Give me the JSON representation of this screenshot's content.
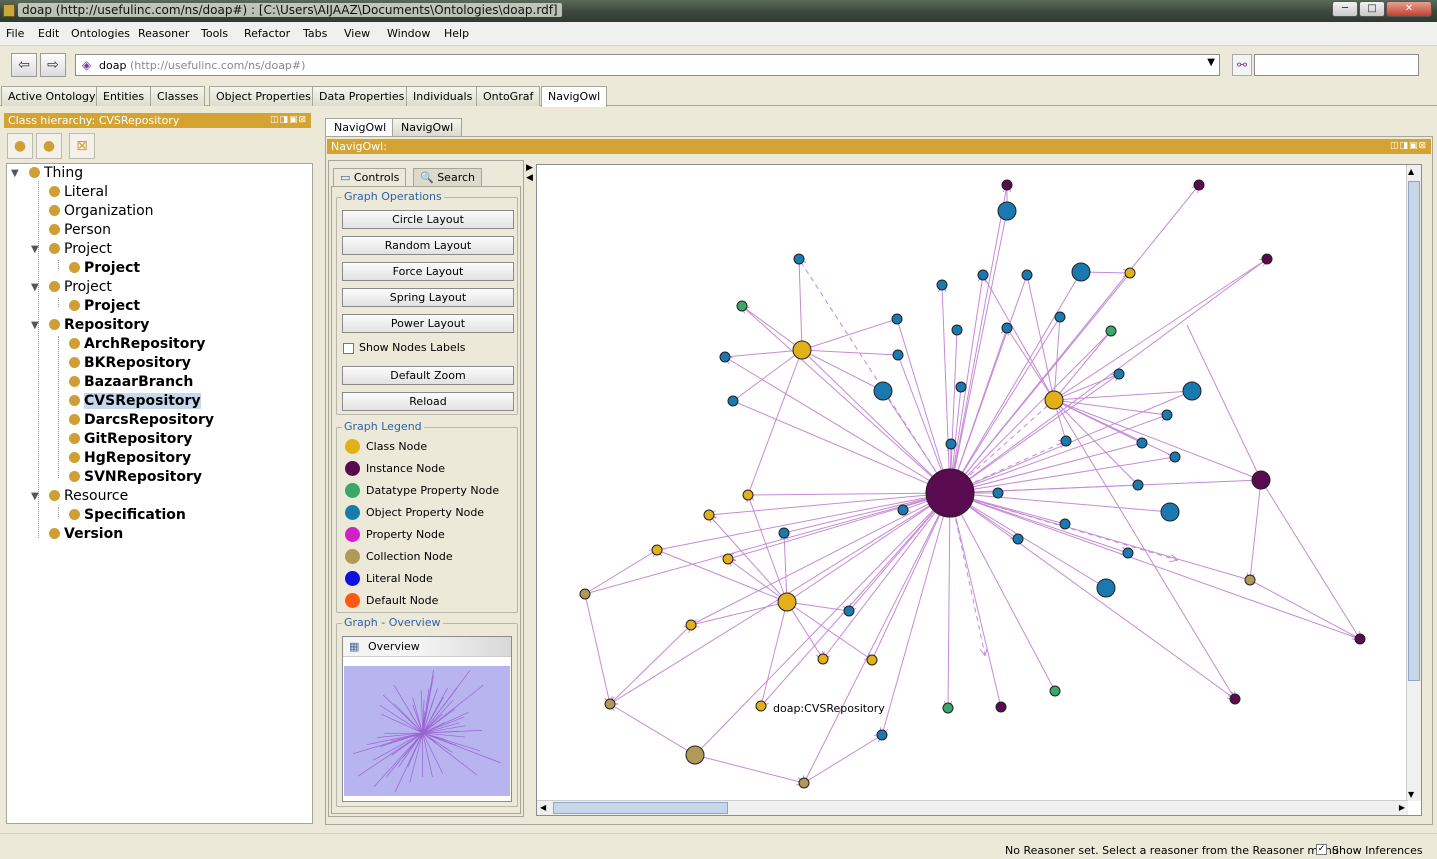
{
  "window": {
    "title": "doap (http://usefulinc.com/ns/doap#) : [C:\\Users\\AIJAAZ\\Documents\\Ontologies\\doap.rdf]",
    "min": "─",
    "max": "□",
    "close": "✕"
  },
  "menu": [
    "File",
    "Edit",
    "Ontologies",
    "Reasoner",
    "Tools",
    "Refactor",
    "Tabs",
    "View",
    "Window",
    "Help"
  ],
  "nav": {
    "back": "⇦",
    "forward": "⇨",
    "ontology_name": "doap",
    "ontology_iri": "(http://usefulinc.com/ns/doap#)",
    "dropdown": "▼",
    "search_value": ""
  },
  "tabs": [
    "Active Ontology",
    "Entities",
    "Classes",
    "Object Properties",
    "Data Properties",
    "Individuals",
    "OntoGraf",
    "NavigOwl"
  ],
  "selected_tab": "NavigOwl",
  "left": {
    "header": "Class hierarchy: CVSRepository",
    "header_controls": "◫◨▣⊠",
    "tree": [
      "Thing",
      "Literal",
      "Organization",
      "Person",
      "Project",
      "Project",
      "Project",
      "Project",
      "Repository",
      "ArchRepository",
      "BKRepository",
      "BazaarBranch",
      "CVSRepository",
      "DarcsRepository",
      "GitRepository",
      "HgRepository",
      "SVNRepository",
      "Resource",
      "Specification",
      "Version"
    ],
    "selected": "CVSRepository"
  },
  "right": {
    "subtabs": [
      "NavigOwl",
      "NavigOwl"
    ],
    "header": "NavigOwl:",
    "header_controls": "◫◨▣⊠",
    "ctrl_tabs": [
      "Controls",
      "Search"
    ],
    "graph_operations": {
      "title": "Graph Operations",
      "buttons": [
        "Circle Layout",
        "Random Layout",
        "Force Layout",
        "Spring Layout",
        "Power Layout"
      ],
      "checkbox": "Show Nodes Labels",
      "checkbox_checked": false,
      "buttons2": [
        "Default Zoom",
        "Reload"
      ]
    },
    "legend": {
      "title": "Graph Legend",
      "items": [
        {
          "label": "Class Node",
          "color": "#e2b018"
        },
        {
          "label": "Instance Node",
          "color": "#5a0a4e"
        },
        {
          "label": "Datatype Property Node",
          "color": "#3aa86a"
        },
        {
          "label": "Object Property Node",
          "color": "#1a7ab0"
        },
        {
          "label": "Property Node",
          "color": "#d020c8"
        },
        {
          "label": "Collection Node",
          "color": "#b09a58"
        },
        {
          "label": "Literal Node",
          "color": "#1010e0"
        },
        {
          "label": "Default Node",
          "color": "#ff5a10"
        }
      ]
    },
    "overview": {
      "title": "Graph - Overview",
      "label": "Overview"
    },
    "graph_label": "doap:CVSRepository"
  },
  "status": {
    "text": "No Reasoner set. Select a reasoner from the Reasoner menu",
    "show_inferences": "Show Inferences",
    "checked": true
  },
  "colors": {
    "edge": "#c68ad6",
    "header": "#d4a332",
    "accent_blue": "#2e5fa8"
  }
}
